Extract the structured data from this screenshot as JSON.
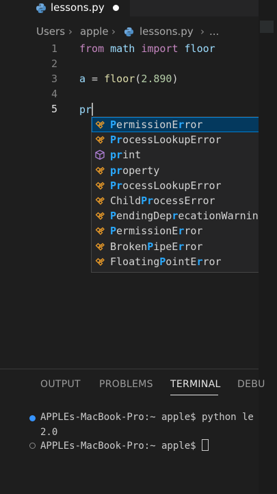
{
  "tab": {
    "filename": "lessons.py",
    "dirty": true
  },
  "breadcrumb": {
    "segments": [
      "Users",
      "apple",
      "lessons.py",
      "..."
    ]
  },
  "editor": {
    "line_numbers": [
      "1",
      "2",
      "3",
      "4",
      "5"
    ],
    "active_line": "5",
    "line1": {
      "kw1": "from",
      "mod": "math",
      "kw2": "import",
      "name": "floor"
    },
    "line3": {
      "var": "a",
      "op": " = ",
      "fn": "floor",
      "open": "(",
      "arg": "2.890",
      "close": ")"
    },
    "line5": {
      "typed": "pr"
    }
  },
  "suggestions": [
    {
      "kind": "class",
      "icon": "class-icon",
      "parts": [
        [
          "P",
          "hl"
        ],
        [
          "ermission",
          ""
        ],
        [
          "E",
          ""
        ],
        [
          "r",
          "hl"
        ],
        [
          "ror",
          ""
        ]
      ]
    },
    {
      "kind": "class",
      "icon": "class-icon",
      "parts": [
        [
          "Pr",
          "hl"
        ],
        [
          "ocessLookupError",
          ""
        ]
      ]
    },
    {
      "kind": "function",
      "icon": "cube-icon",
      "parts": [
        [
          "pr",
          "hl"
        ],
        [
          "int",
          ""
        ]
      ]
    },
    {
      "kind": "class",
      "icon": "class-icon",
      "parts": [
        [
          "pr",
          "hl"
        ],
        [
          "operty",
          ""
        ]
      ]
    },
    {
      "kind": "class",
      "icon": "class-icon",
      "parts": [
        [
          "Pr",
          "hl"
        ],
        [
          "ocessLookupError",
          ""
        ]
      ]
    },
    {
      "kind": "class",
      "icon": "class-icon",
      "parts": [
        [
          "Child",
          ""
        ],
        [
          "Pr",
          "hl"
        ],
        [
          "ocessError",
          ""
        ]
      ]
    },
    {
      "kind": "class",
      "icon": "class-icon",
      "parts": [
        [
          "P",
          "hl"
        ],
        [
          "endingDep",
          ""
        ],
        [
          "r",
          "hl"
        ],
        [
          "ecationWarning",
          ""
        ]
      ]
    },
    {
      "kind": "class",
      "icon": "class-icon",
      "parts": [
        [
          "P",
          "hl"
        ],
        [
          "ermissionE",
          ""
        ],
        [
          "r",
          "hl"
        ],
        [
          "ror",
          ""
        ]
      ]
    },
    {
      "kind": "class",
      "icon": "class-icon",
      "parts": [
        [
          "Broken",
          ""
        ],
        [
          "P",
          "hl"
        ],
        [
          "ipeE",
          ""
        ],
        [
          "r",
          "hl"
        ],
        [
          "ror",
          ""
        ]
      ]
    },
    {
      "kind": "class",
      "icon": "class-icon",
      "parts": [
        [
          "Floating",
          ""
        ],
        [
          "P",
          "hl"
        ],
        [
          "ointE",
          ""
        ],
        [
          "r",
          "hl"
        ],
        [
          "ror",
          ""
        ]
      ]
    }
  ],
  "panel": {
    "tabs": [
      "OUTPUT",
      "PROBLEMS",
      "TERMINAL",
      "DEBU"
    ],
    "active_tab": "TERMINAL"
  },
  "terminal": {
    "line1": "APPLEs-MacBook-Pro:~ apple$ python le",
    "line2": "2.0",
    "line3": "APPLEs-MacBook-Pro:~ apple$ "
  },
  "colors": {
    "accent": "#007fd4",
    "highlight": "#2aaaff",
    "class_icon": "#ee9d28",
    "function_icon": "#b180d7"
  }
}
